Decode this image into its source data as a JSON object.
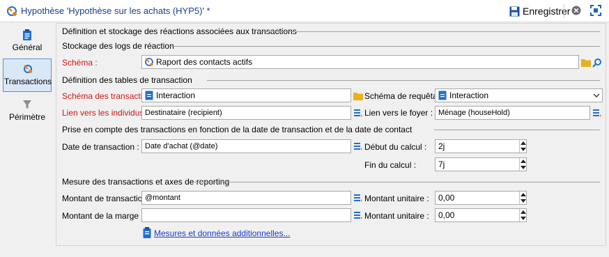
{
  "window": {
    "title": "Hypothèse 'Hypothèse sur les achats (HYP5)' *",
    "save_label": "Enregistrer"
  },
  "sidebar": {
    "items": [
      {
        "label": "Général",
        "icon": "clipboard-icon"
      },
      {
        "label": "Transactions",
        "icon": "transactions-icon",
        "active": true
      },
      {
        "label": "Périmètre",
        "icon": "filter-icon"
      }
    ]
  },
  "main": {
    "section_title": "Définition et stockage des réactions associées aux transactions",
    "logs": {
      "title": "Stockage des logs de réaction",
      "schema_label": "Schéma :",
      "schema_value": "Raport des contacts actifs"
    },
    "tables": {
      "title": "Définition des tables de transaction",
      "trans_schema_label": "Schéma des transactions :",
      "trans_schema_value": "Interaction",
      "query_schema_label": "Schéma de requêtage :",
      "query_schema_value": "Interaction",
      "individuals_link_label": "Lien vers les individus :",
      "individuals_link_value": "Destinataire (recipient)",
      "household_link_label": "Lien vers le foyer :",
      "household_link_value": "Ménage (houseHold)"
    },
    "date": {
      "title": "Prise en compte des transactions en fonction de la date de transaction et de la date de contact",
      "trans_date_label": "Date de transaction :",
      "trans_date_value": "Date d'achat (@date)",
      "calc_start_label": "Début du calcul :",
      "calc_start_value": "2j",
      "calc_end_label": "Fin du calcul :",
      "calc_end_value": "7j"
    },
    "measure": {
      "title": "Mesure des transactions et axes de reporting",
      "amount_label": "Montant de transaction :",
      "amount_value": "@montant",
      "unit_amount_label_1": "Montant unitaire :",
      "unit_amount_value_1": "0,00",
      "margin_label": "Montant de la marge :",
      "margin_value": "",
      "unit_amount_label_2": "Montant unitaire :",
      "unit_amount_value_2": "0,00",
      "more_link": "Mesures et données additionnelles..."
    }
  },
  "colors": {
    "title_text": "#1a3f8b",
    "required_label": "#d21414",
    "active_tab_bg": "#d9e8f7",
    "link": "#1a3ec8"
  }
}
